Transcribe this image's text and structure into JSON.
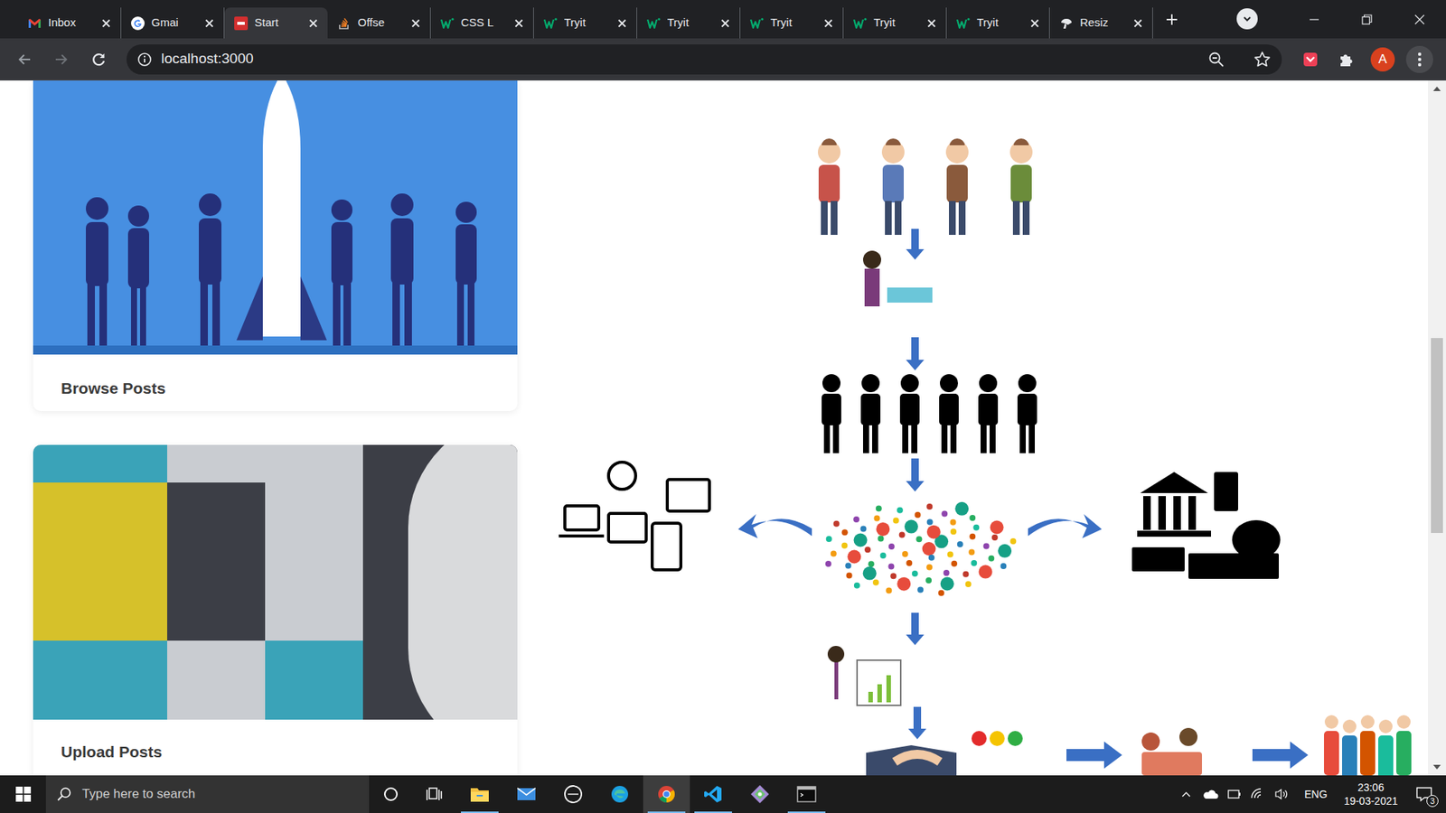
{
  "browser": {
    "tabs": [
      {
        "label": "Inbox",
        "selected": false
      },
      {
        "label": "Gmai",
        "selected": false
      },
      {
        "label": "Start",
        "selected": true
      },
      {
        "label": "Offse",
        "selected": false
      },
      {
        "label": "CSS L",
        "selected": false
      },
      {
        "label": "Tryit",
        "selected": false
      },
      {
        "label": "Tryit",
        "selected": false
      },
      {
        "label": "Tryit",
        "selected": false
      },
      {
        "label": "Tryit",
        "selected": false
      },
      {
        "label": "Tryit",
        "selected": false
      },
      {
        "label": "Resiz",
        "selected": false
      }
    ],
    "address": "localhost:3000",
    "profile": "A"
  },
  "page": {
    "cards": [
      {
        "title": "Browse Posts"
      },
      {
        "title": "Upload Posts"
      }
    ]
  },
  "taskbar": {
    "search_placeholder": "Type here to search",
    "apps": [
      {
        "running": true,
        "selected": false
      },
      {
        "running": false,
        "selected": false
      },
      {
        "running": false,
        "selected": false
      },
      {
        "running": false,
        "selected": false
      },
      {
        "running": true,
        "selected": true
      },
      {
        "running": true,
        "selected": false
      },
      {
        "running": false,
        "selected": false
      },
      {
        "running": true,
        "selected": false
      }
    ],
    "language": "ENG",
    "time": "23:06",
    "date": "19-03-2021",
    "notifications": "3"
  }
}
